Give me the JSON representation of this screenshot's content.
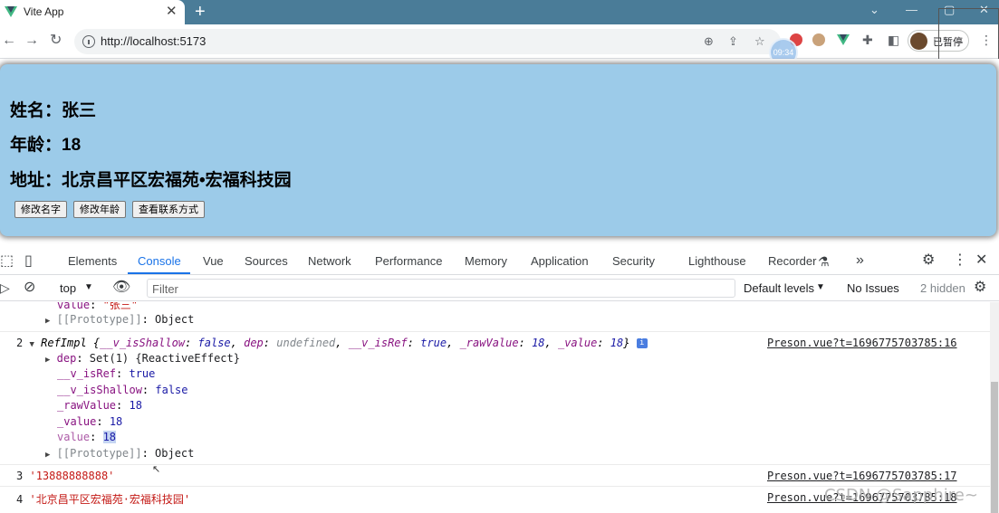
{
  "browser": {
    "tab_title": "Vite App",
    "tab_close": "✕",
    "new_tab": "+",
    "url": "http://localhost:5173",
    "profile_label": "已暂停",
    "timer_text": "09:34"
  },
  "page": {
    "name_line": "姓名：张三",
    "age_line": "年龄：18",
    "address_line": "地址：北京昌平区宏福苑•宏福科技园",
    "buttons": {
      "change_name": "修改名字",
      "change_age": "修改年龄",
      "view_contact": "查看联系方式"
    },
    "card_color": "#9ccbe9"
  },
  "devtools": {
    "tabs": [
      "Elements",
      "Console",
      "Vue",
      "Sources",
      "Network",
      "Performance",
      "Memory",
      "Application",
      "Security",
      "Lighthouse",
      "Recorder"
    ],
    "active_tab": "Console",
    "context": "top",
    "filter_placeholder": "Filter",
    "levels": "Default levels",
    "issues": "No Issues",
    "hidden": "2 hidden"
  },
  "console": {
    "line0_value_key": "value",
    "line0_value": "\"张三\"",
    "line0_proto_key": "[[Prototype]]",
    "line0_proto_val": "Object",
    "entry2": {
      "index": "2",
      "summary_prefix": "RefImpl {",
      "summary_isShallow_key": "__v_isShallow",
      "summary_isShallow_val": "false",
      "summary_dep_key": "dep",
      "summary_dep_val": "undefined",
      "summary_isRef_key": "__v_isRef",
      "summary_isRef_val": "true",
      "summary_rawValue_key": "_rawValue",
      "summary_rawValue_val": "18",
      "summary_value_key": "_value",
      "summary_value_val": "18",
      "source": "Preson.vue?t=1696775703785:16",
      "dep_key": "dep",
      "dep_val": "Set(1) {ReactiveEffect}",
      "isRef_key": "__v_isRef",
      "isRef_val": "true",
      "isShallow_key": "__v_isShallow",
      "isShallow_val": "false",
      "rawValue_key": "_rawValue",
      "rawValue_val": "18",
      "value_u_key": "_value",
      "value_u_val": "18",
      "value_key": "value",
      "value_val": "18",
      "proto_key": "[[Prototype]]",
      "proto_val": "Object"
    },
    "entry3": {
      "index": "3",
      "text": "'13888888888'",
      "source": "Preson.vue?t=1696775703785:17"
    },
    "entry4": {
      "index": "4",
      "text": "'北京昌平区宏福苑·宏福科技园'",
      "source": "Preson.vue?t=1696775703785:18"
    }
  },
  "watermark": "CSDN @Sapphire~"
}
